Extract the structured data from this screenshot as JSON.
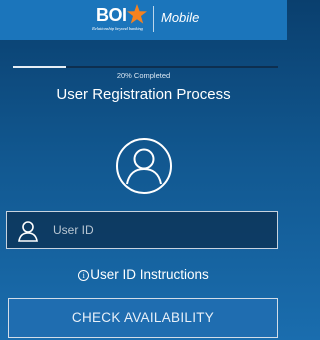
{
  "header": {
    "logo_text": "BOI",
    "logo_tagline": "Relationship beyond banking",
    "app_name": "Mobile",
    "accent_color": "#1b75bb",
    "star_color": "#f58220"
  },
  "progress": {
    "label": "20% Completed",
    "fraction": 0.2
  },
  "page": {
    "title": "User Registration Process",
    "avatar_icon": "user-avatar-icon"
  },
  "form": {
    "user_id_placeholder": "User ID",
    "user_id_value": "",
    "field_icon": "user-icon",
    "instructions_label": "User ID Instructions",
    "instructions_icon": "info-icon"
  },
  "actions": {
    "check_label": "CHECK AVAILABILITY"
  }
}
